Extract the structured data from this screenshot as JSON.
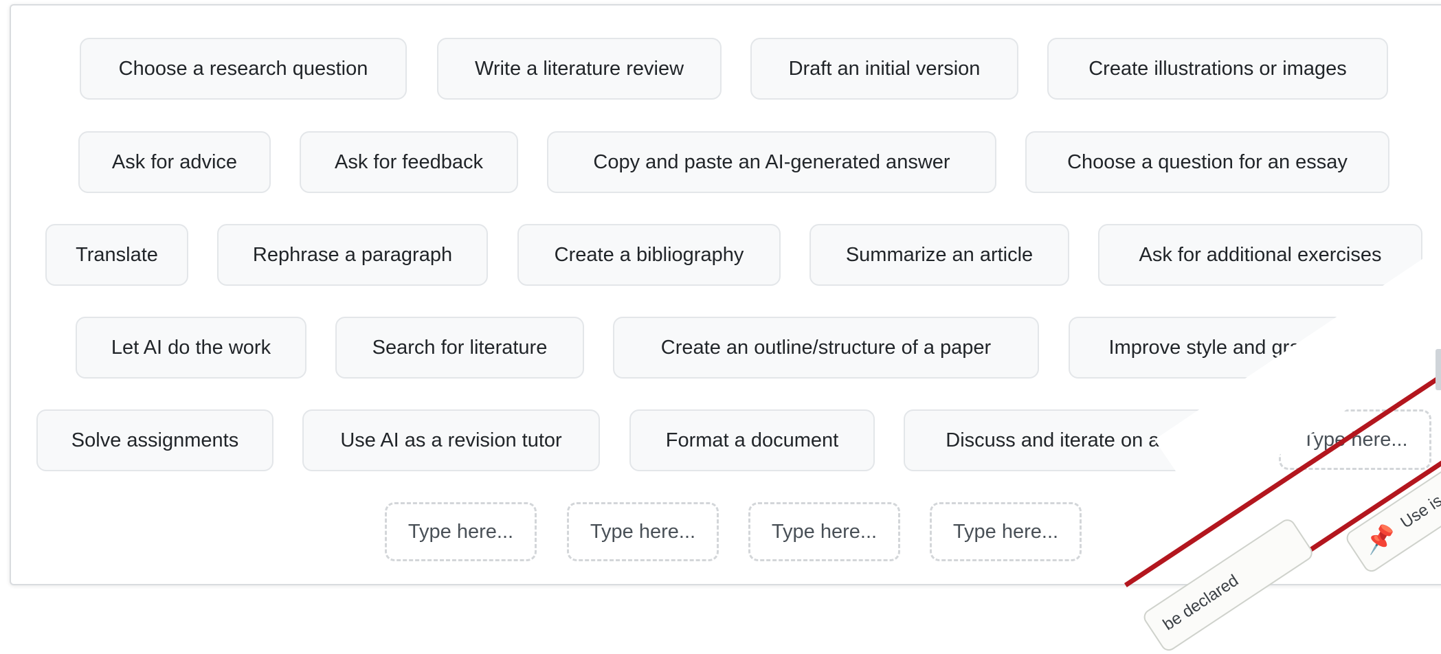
{
  "rows": [
    [
      "Choose a research question",
      "Write a literature review",
      "Draft an initial version",
      "Create illustrations or images"
    ],
    [
      "Ask for advice",
      "Ask for feedback",
      "Copy and paste an AI-generated answer",
      "Choose a question for an essay"
    ],
    [
      "Translate",
      "Rephrase a paragraph",
      "Create a bibliography",
      "Summarize an article",
      "Ask for additional exercises"
    ],
    [
      "Let AI do the work",
      "Search for literature",
      "Create an outline/structure of a paper",
      "Improve style and grammar"
    ],
    [
      "Solve assignments",
      "Use AI as a revision tutor",
      "Format a document",
      "Discuss and iterate on a topic"
    ]
  ],
  "placeholder": "Type here...",
  "overlay": {
    "tag_partial_left": "be declared",
    "tag_partial_right": "Use is r",
    "pin_icon": "pushpin-icon",
    "stripe_color": "#b3161e"
  }
}
